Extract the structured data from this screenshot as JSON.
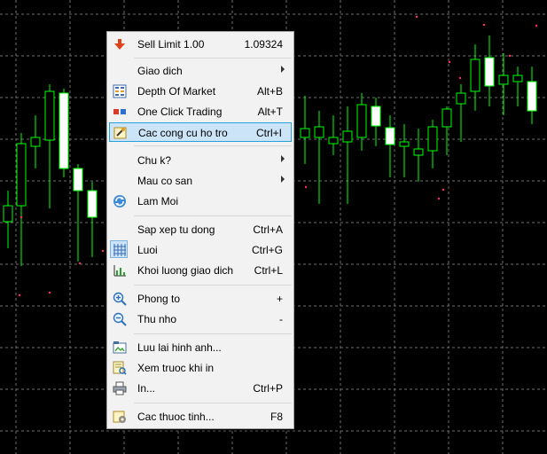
{
  "colors": {
    "background": "#000000",
    "grid": "#6e6e6e",
    "candle_up": "#ffffff",
    "candle_outline": "#00ff00",
    "wick": "#00ff00",
    "menu_bg": "#f2f2f2",
    "menu_highlight": "#cce4f7",
    "menu_highlight_border": "#26a0da"
  },
  "menu": {
    "items": [
      {
        "label": "Sell Limit 1.00",
        "shortcut": "1.09324",
        "icon": "sell-arrow-icon",
        "submenu": false
      },
      {
        "label": "Giao dich",
        "shortcut": "",
        "icon": "",
        "submenu": true
      },
      {
        "label": "Depth Of Market",
        "shortcut": "Alt+B",
        "icon": "depth-of-market-icon",
        "submenu": false
      },
      {
        "label": "One Click Trading",
        "shortcut": "Alt+T",
        "icon": "one-click-trading-icon",
        "submenu": false
      },
      {
        "label": "Cac cong cu ho tro",
        "shortcut": "Ctrl+I",
        "icon": "tools-icon",
        "submenu": false,
        "highlighted": true
      },
      {
        "label": "Chu k?",
        "shortcut": "",
        "icon": "",
        "submenu": true
      },
      {
        "label": "Mau co san",
        "shortcut": "",
        "icon": "",
        "submenu": true
      },
      {
        "label": "Lam Moi",
        "shortcut": "",
        "icon": "refresh-icon",
        "submenu": false
      },
      {
        "label": "Sap xep tu dong",
        "shortcut": "Ctrl+A",
        "icon": "",
        "submenu": false
      },
      {
        "label": "Luoi",
        "shortcut": "Ctrl+G",
        "icon": "grid-icon",
        "submenu": false,
        "checked": true
      },
      {
        "label": "Khoi luong giao dich",
        "shortcut": "Ctrl+L",
        "icon": "volume-icon",
        "submenu": false
      },
      {
        "label": "Phong to",
        "shortcut": "+",
        "icon": "zoom-in-icon",
        "submenu": false
      },
      {
        "label": "Thu nho",
        "shortcut": "-",
        "icon": "zoom-out-icon",
        "submenu": false
      },
      {
        "label": "Luu lai hinh anh...",
        "shortcut": "",
        "icon": "save-image-icon",
        "submenu": false
      },
      {
        "label": "Xem truoc khi in",
        "shortcut": "",
        "icon": "print-preview-icon",
        "submenu": false
      },
      {
        "label": "In...",
        "shortcut": "Ctrl+P",
        "icon": "print-icon",
        "submenu": false
      },
      {
        "label": "Cac thuoc tinh...",
        "shortcut": "F8",
        "icon": "properties-icon",
        "submenu": false
      }
    ]
  }
}
